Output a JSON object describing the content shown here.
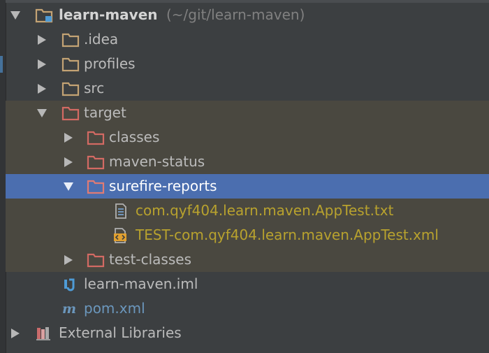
{
  "project": {
    "name": "learn-maven",
    "path": "(~/git/learn-maven)"
  },
  "tree": {
    "idea": ".idea",
    "profiles": "profiles",
    "src": "src",
    "target": "target",
    "classes": "classes",
    "maven_status": "maven-status",
    "surefire_reports": "surefire-reports",
    "txt_file": "com.qyf404.learn.maven.AppTest.txt",
    "xml_file": "TEST-com.qyf404.learn.maven.AppTest.xml",
    "test_classes": "test-classes",
    "iml_file": "learn-maven.iml",
    "pom_file": "pom.xml",
    "external_libraries": "External Libraries"
  },
  "colors": {
    "background": "#3c3f41",
    "selection": "#4b6eaf",
    "excluded_row": "#4a4840",
    "folder_normal": "#c4a374",
    "folder_excluded": "#d36a63",
    "unversioned_file_text": "#b8a22e",
    "pom_text": "#6b97bd"
  }
}
